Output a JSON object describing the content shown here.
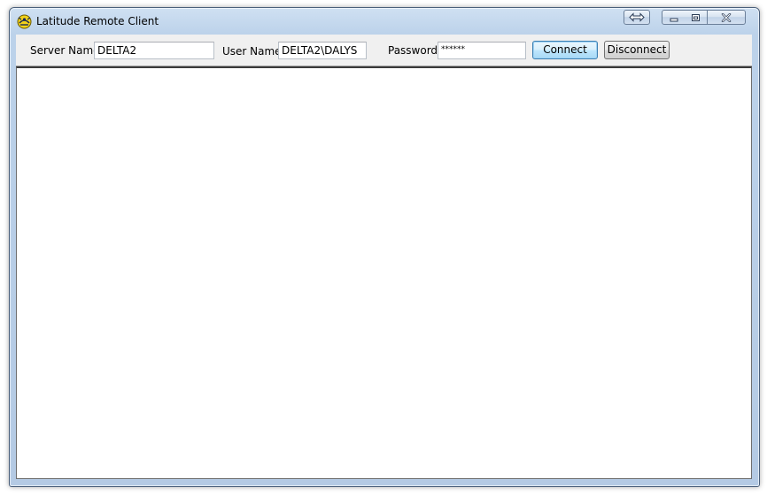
{
  "window": {
    "title": "Latitude Remote Client",
    "icon": "app-logo-icon"
  },
  "titlebar_buttons": {
    "resize_icon": "resize-arrows-icon",
    "minimize_icon": "minimize-icon",
    "maximize_icon": "restore-icon",
    "close_icon": "close-icon"
  },
  "toolbar": {
    "server_name_label": "Server Name",
    "server_name_value": "DELTA2",
    "user_name_label": "User Name",
    "user_name_value": "DELTA2\\DALYS",
    "password_label": "Password",
    "password_value": "******",
    "connect_label": "Connect",
    "disconnect_label": "Disconnect"
  },
  "colors": {
    "frame": "#bcd2ea",
    "toolbar_bg": "#f0f0f0",
    "content_bg": "#ffffff",
    "default_button_border": "#3c7fb1"
  }
}
